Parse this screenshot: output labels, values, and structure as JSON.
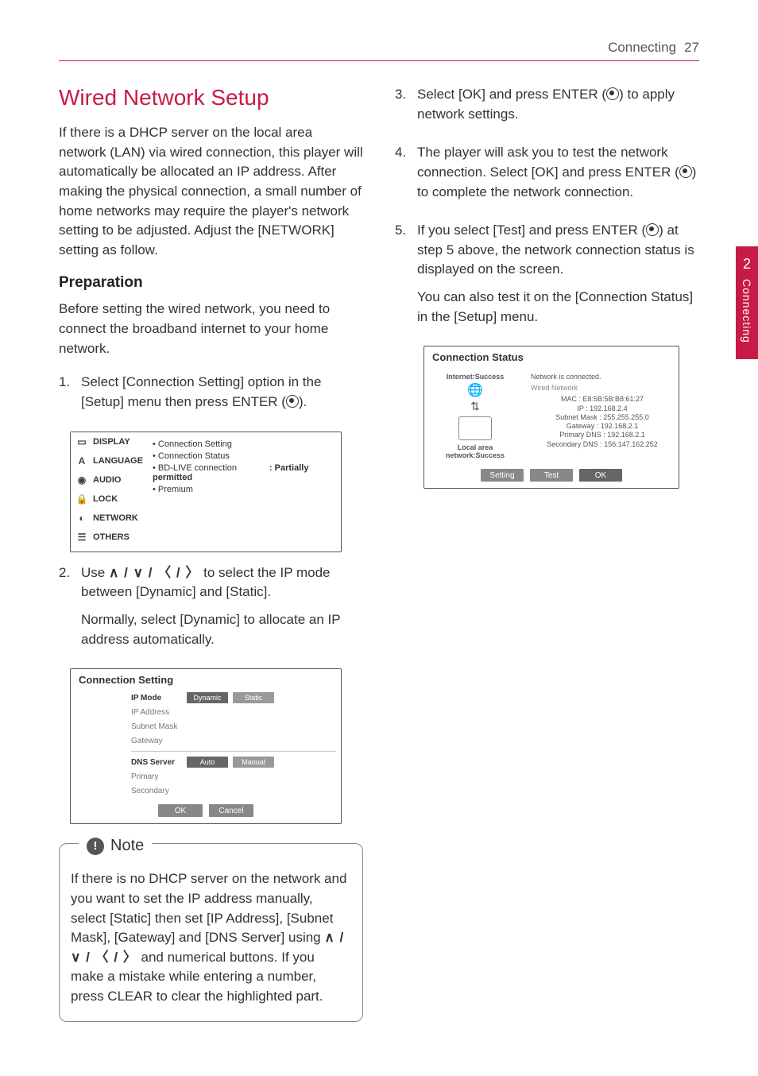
{
  "header": {
    "section": "Connecting",
    "page": "27"
  },
  "sidetab": {
    "num": "2",
    "label": "Connecting"
  },
  "left": {
    "title": "Wired Network Setup",
    "intro": "If there is a DHCP server on the local area network (LAN) via wired connection, this player will automatically be allocated an IP address. After making the physical connection, a small number of home networks may require the player's network setting to be adjusted. Adjust the [NETWORK] setting as follow.",
    "prep_heading": "Preparation",
    "prep_body": "Before setting the wired network, you need to connect the broadband internet to your home network.",
    "step1_num": "1.",
    "step1_a": "Select [Connection Setting] option in the [Setup] menu then press ENTER (",
    "step1_b": ").",
    "step2_num": "2.",
    "step2_a": "Use ",
    "step2_arrows": "∧ / ∨ / 〈 / 〉",
    "step2_b": " to select the IP mode between [Dynamic] and [Static].",
    "step2_c": "Normally, select [Dynamic] to allocate an IP address automatically.",
    "shot1": {
      "menu": [
        "DISPLAY",
        "LANGUAGE",
        "AUDIO",
        "LOCK",
        "NETWORK",
        "OTHERS"
      ],
      "items": [
        {
          "label": "Connection Setting",
          "value": ""
        },
        {
          "label": "Connection Status",
          "value": ""
        },
        {
          "label": "BD-LIVE connection",
          "value": ": Partially permitted"
        },
        {
          "label": "Premium",
          "value": ""
        }
      ]
    },
    "shot2": {
      "title": "Connection Setting",
      "rows": [
        {
          "k": "IP Mode",
          "b1": "Dynamic",
          "b2": "Static"
        },
        {
          "k": "IP Address"
        },
        {
          "k": "Subnet Mask"
        },
        {
          "k": "Gateway"
        }
      ],
      "rows2": [
        {
          "k": "DNS Server",
          "b1": "Auto",
          "b2": "Manual"
        },
        {
          "k": "Primary"
        },
        {
          "k": "Secondary"
        }
      ],
      "ok": "OK",
      "cancel": "Cancel"
    },
    "note_label": "Note",
    "note_a": "If there is no DHCP server on the network and you want to set the IP address manually, select [Static] then set [IP Address], [Subnet Mask], [Gateway] and [DNS Server] using ",
    "note_arrows": "∧ / ∨ / 〈 / 〉",
    "note_b": " and numerical buttons. If you make a mistake while entering a number, press CLEAR to clear the highlighted part."
  },
  "right": {
    "step3_num": "3.",
    "step3_a": "Select [OK] and press ENTER (",
    "step3_b": ") to apply network settings.",
    "step4_num": "4.",
    "step4_a": "The player will ask you to test the network connection. Select [OK] and press ENTER (",
    "step4_b": ") to complete the network connection.",
    "step5_num": "5.",
    "step5_a": "If you select [Test] and press ENTER (",
    "step5_b": ") at step 5 above, the network connection status is displayed on the screen.",
    "step5_c": "You can also test it on the [Connection Status] in the [Setup] menu.",
    "shot3": {
      "title": "Connection Status",
      "internet": "Internet:Success",
      "lan": "Local area network:Success",
      "msg": "Network is connected.",
      "type": "Wired Network",
      "mac": "MAC : E8:5B:5B:B8:61:27",
      "ip": "IP : 192.168.2.4",
      "mask": "Subnet Mask : 255.255.255.0",
      "gw": "Gateway : 192.168.2.1",
      "pdns": "Primary DNS : 192.168.2.1",
      "sdns": "Secondary DNS : 156.147.162.252",
      "setting": "Setting",
      "test": "Test",
      "ok": "OK"
    }
  }
}
